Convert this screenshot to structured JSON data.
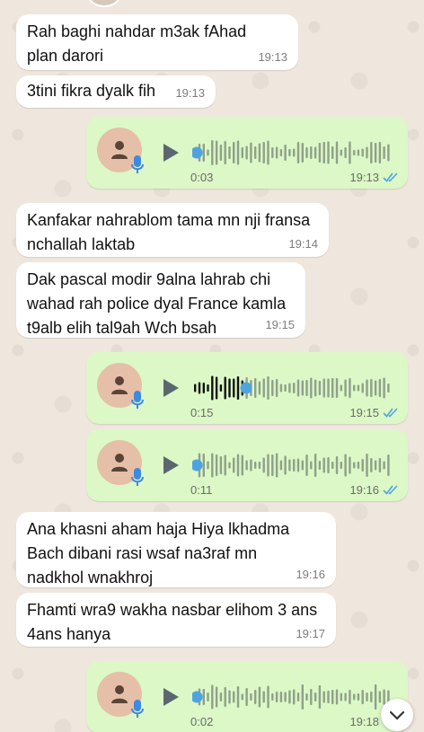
{
  "messages": [
    {
      "text": "Rah baghi nahdar m3ak fAhad plan darori",
      "time": "19:13"
    },
    {
      "text": "3tini fikra dyalk fih",
      "time": "19:13"
    },
    {
      "text": "Kanfakar nahrablom tama mn nji fransa nchallah laktab",
      "time": "19:14"
    },
    {
      "text": "Dak pascal modir 9alna lahrab chi wahad rah police dyal France kamla t9alb elih tal9ah Wch bsah",
      "time": "19:15"
    },
    {
      "text": "Ana khasni aham haja Hiya lkhadma Bach dibani rasi wsaf na3raf mn nadkhol wnakhroj",
      "time": "19:16"
    },
    {
      "text": "Fhamti wra9 wakha nasbar elihom 3 ans 4ans hanya",
      "time": "19:17"
    }
  ],
  "voice_notes": [
    {
      "duration": "0:03",
      "time": "19:13",
      "progress": 0.0,
      "status": "read"
    },
    {
      "duration": "0:15",
      "time": "19:15",
      "progress": 0.25,
      "status": "read"
    },
    {
      "duration": "0:11",
      "time": "19:16",
      "progress": 0.0,
      "status": "read"
    },
    {
      "duration": "0:02",
      "time": "19:18",
      "progress": 0.0,
      "status": "read"
    }
  ],
  "colors": {
    "outgoing_bubble": "#dcf8c6",
    "incoming_bubble": "#ffffff",
    "read_ticks": "#4fa3e0",
    "wave_played": "#111111",
    "wave_unplayed": "#8fa08a"
  },
  "icons": {
    "avatar": "person-icon",
    "mic": "microphone-icon",
    "play": "play-icon",
    "ticks": "double-check-icon",
    "scroll": "chevron-down-icon"
  }
}
